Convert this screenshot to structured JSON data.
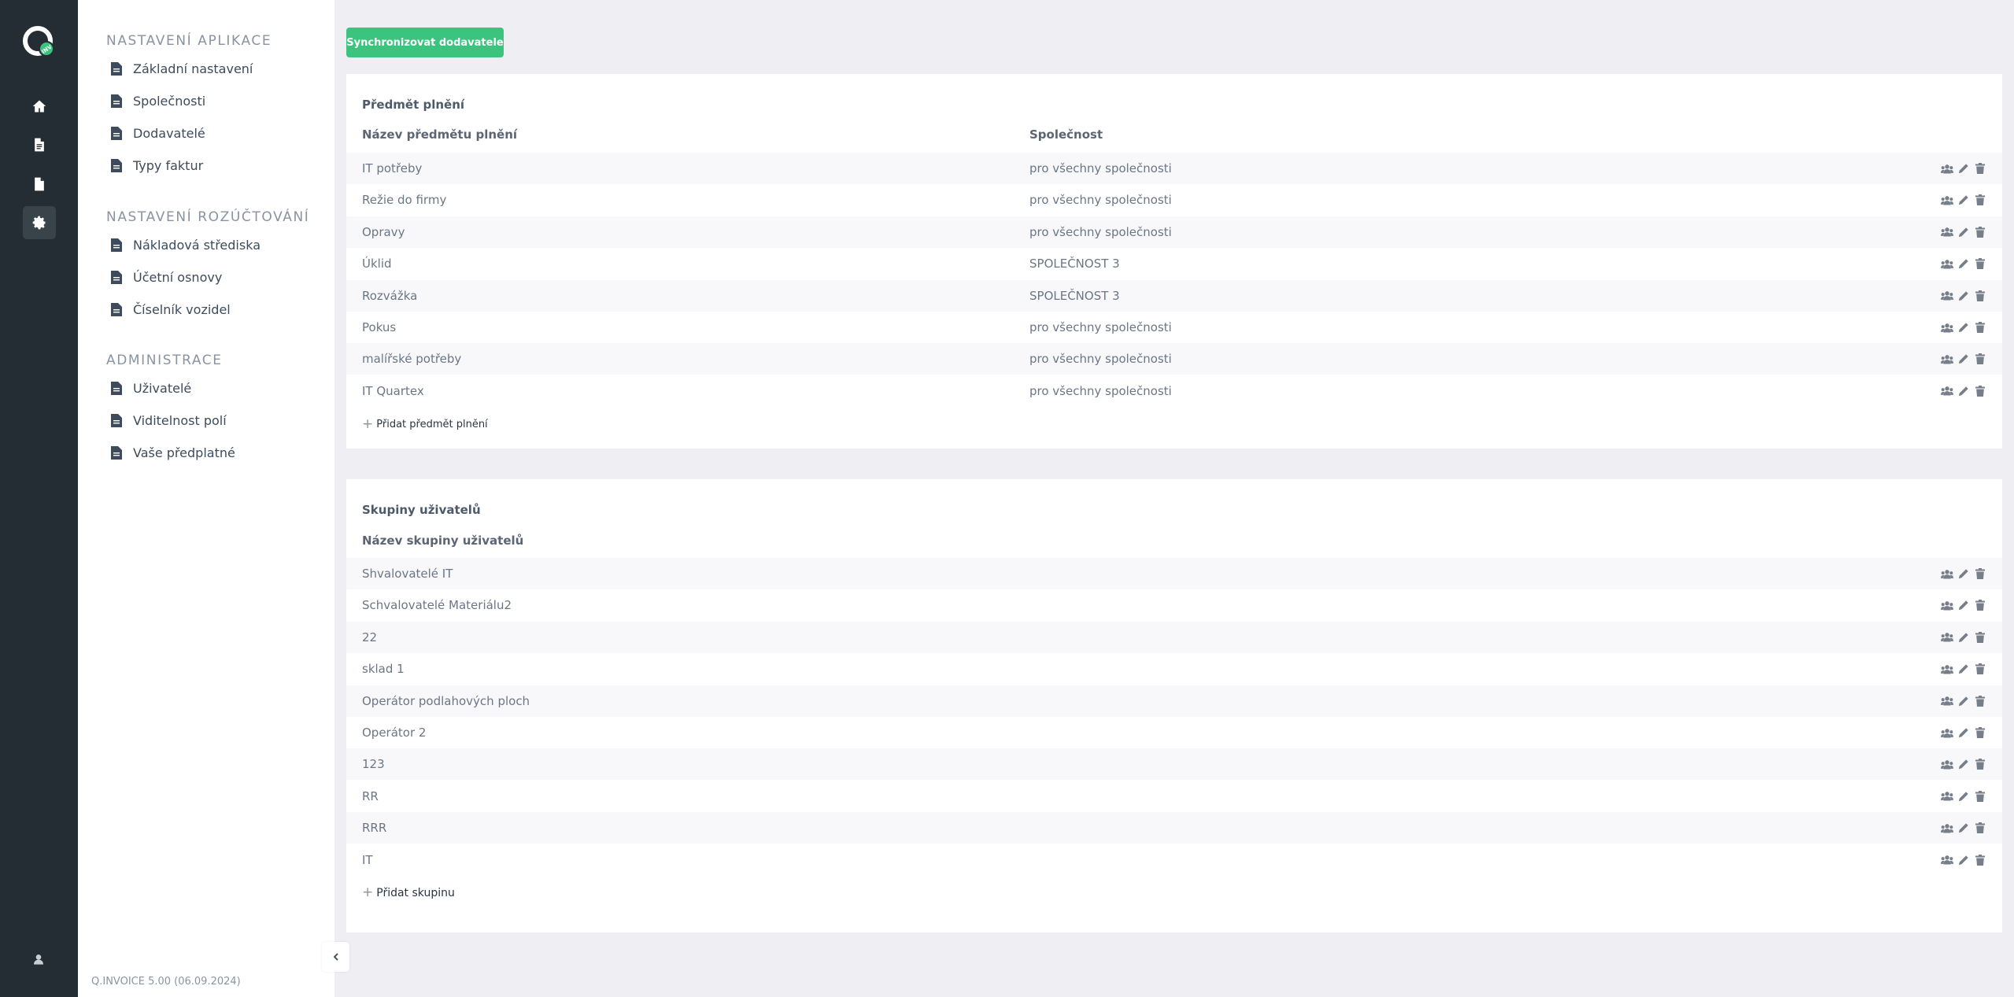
{
  "app": {
    "version": "Q.INVOICE 5.00 (06.09.2024)",
    "logo_badge": "INV"
  },
  "rail": {
    "items": [
      {
        "icon": "home-icon"
      },
      {
        "icon": "document-icon"
      },
      {
        "icon": "document-alt-icon"
      },
      {
        "icon": "gear-icon",
        "active": true
      }
    ],
    "bottom_icon": "user-icon"
  },
  "sidebar": {
    "sections": [
      {
        "title": "Nastavení aplikace",
        "items": [
          "Základní nastavení",
          "Společnosti",
          "Dodavatelé",
          "Typy faktur"
        ]
      },
      {
        "title": "Nastavení rozúčtování",
        "items": [
          "Nákladová střediska",
          "Účetní osnovy",
          "Číselník vozidel"
        ]
      },
      {
        "title": "Administrace",
        "items": [
          "Uživatelé",
          "Viditelnost polí",
          "Vaše předplatné"
        ]
      }
    ]
  },
  "toolbar": {
    "sync_label": "Synchronizovat dodavatele"
  },
  "subjects": {
    "title": "Předmět plnění",
    "columns": [
      "Název předmětu plnění",
      "Společnost"
    ],
    "rows": [
      [
        "IT potřeby",
        "pro všechny společnosti"
      ],
      [
        "Režie do firmy",
        "pro všechny společnosti"
      ],
      [
        "Opravy",
        "pro všechny společnosti"
      ],
      [
        "Úklid",
        "SPOLEČNOST 3"
      ],
      [
        "Rozvážka",
        "SPOLEČNOST 3"
      ],
      [
        "Pokus",
        "pro všechny společnosti"
      ],
      [
        "malířské potřeby",
        "pro všechny společnosti"
      ],
      [
        "IT Quartex",
        "pro všechny společnosti"
      ]
    ],
    "add_label": "Přidat předmět plnění"
  },
  "groups": {
    "title": "Skupiny uživatelů",
    "columns": [
      "Název skupiny uživatelů"
    ],
    "rows": [
      "Shvalovatelé IT",
      "Schvalovatelé Materiálu2",
      "22",
      "sklad 1",
      "Operátor podlahových ploch",
      "Operátor 2",
      "123",
      "RR",
      "RRR",
      "IT"
    ],
    "add_label": "Přidat skupinu"
  },
  "colors": {
    "rail": "#242d33",
    "accent_green": "#3cc47f",
    "background": "#eeeef3"
  }
}
